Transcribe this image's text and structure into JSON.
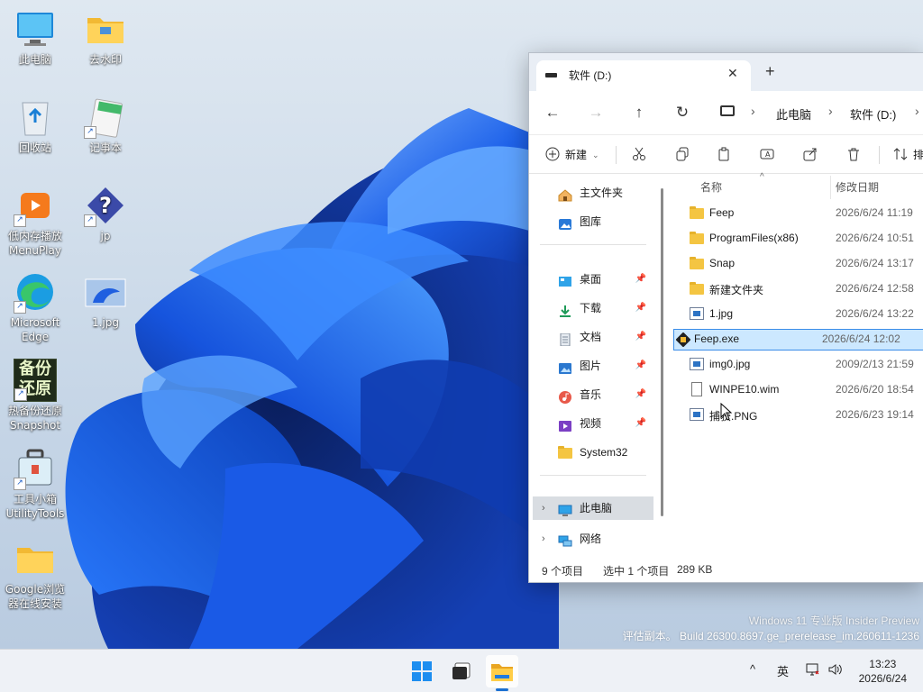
{
  "desktop": {
    "icons": [
      {
        "label": "此电脑",
        "icon": "computer-icon"
      },
      {
        "label": "去水印",
        "icon": "folder-icon"
      },
      {
        "label": "回收站",
        "icon": "recycle-bin-icon"
      },
      {
        "label": "记事本",
        "icon": "notepad-icon"
      },
      {
        "label": "低内存播放\nMenuPlay",
        "icon": "media-player-icon"
      },
      {
        "label": "jp",
        "icon": "unknown-file-icon"
      },
      {
        "label": "Microsoft\nEdge",
        "icon": "edge-icon"
      },
      {
        "label": "1.jpg",
        "icon": "image-file-icon"
      },
      {
        "label": "热备份还原\nSnapshot",
        "icon": "snapshot-backup-icon"
      },
      {
        "label": "工具小箱\nUtilityTools",
        "icon": "toolbox-icon"
      },
      {
        "label": "Google浏览\n器在线安装",
        "icon": "folder-icon"
      }
    ],
    "backup_logo_text": [
      "备份",
      "还原"
    ]
  },
  "explorer": {
    "tab_title": "软件 (D:)",
    "breadcrumb": [
      "此电脑",
      "软件 (D:)"
    ],
    "commands": {
      "new_label": "新建",
      "sort_label": "排"
    },
    "nav": {
      "top": [
        {
          "label": "主文件夹",
          "icon": "home-icon"
        },
        {
          "label": "图库",
          "icon": "gallery-icon"
        }
      ],
      "pinned": [
        {
          "label": "桌面",
          "icon": "desktop-icon"
        },
        {
          "label": "下载",
          "icon": "download-icon"
        },
        {
          "label": "文档",
          "icon": "document-icon"
        },
        {
          "label": "图片",
          "icon": "pictures-icon"
        },
        {
          "label": "音乐",
          "icon": "music-icon"
        },
        {
          "label": "视频",
          "icon": "video-icon"
        },
        {
          "label": "System32",
          "icon": "folder-icon"
        }
      ],
      "bottom": [
        {
          "label": "此电脑",
          "icon": "computer-icon",
          "selected": true
        },
        {
          "label": "网络",
          "icon": "network-icon"
        }
      ]
    },
    "columns": {
      "name": "名称",
      "modified": "修改日期"
    },
    "files": [
      {
        "name": "Feep",
        "date": "2026/6/24 11:19",
        "type": "folder"
      },
      {
        "name": "ProgramFiles(x86)",
        "date": "2026/6/24 10:51",
        "type": "folder"
      },
      {
        "name": "Snap",
        "date": "2026/6/24 13:17",
        "type": "folder"
      },
      {
        "name": "新建文件夹",
        "date": "2026/6/24 12:58",
        "type": "folder"
      },
      {
        "name": "1.jpg",
        "date": "2026/6/24 13:22",
        "type": "image"
      },
      {
        "name": "Feep.exe",
        "date": "2026/6/24 12:02",
        "type": "exe",
        "selected": true
      },
      {
        "name": "img0.jpg",
        "date": "2009/2/13 21:59",
        "type": "image"
      },
      {
        "name": "WINPE10.wim",
        "date": "2026/6/20 18:54",
        "type": "file"
      },
      {
        "name": "捕获.PNG",
        "date": "2026/6/23 19:14",
        "type": "image"
      }
    ],
    "status": {
      "count": "9 个项目",
      "selection": "选中 1 个项目",
      "size": "289 KB"
    }
  },
  "watermark": {
    "line1": "Windows 11 专业版 Insider Preview",
    "line2": "评估副本。 Build 26300.8697.ge_prerelease_im.260611-1236"
  },
  "taskbar": {
    "ime": "英",
    "time": "13:23",
    "date": "2026/6/24",
    "accent": "#1a6fd1"
  }
}
